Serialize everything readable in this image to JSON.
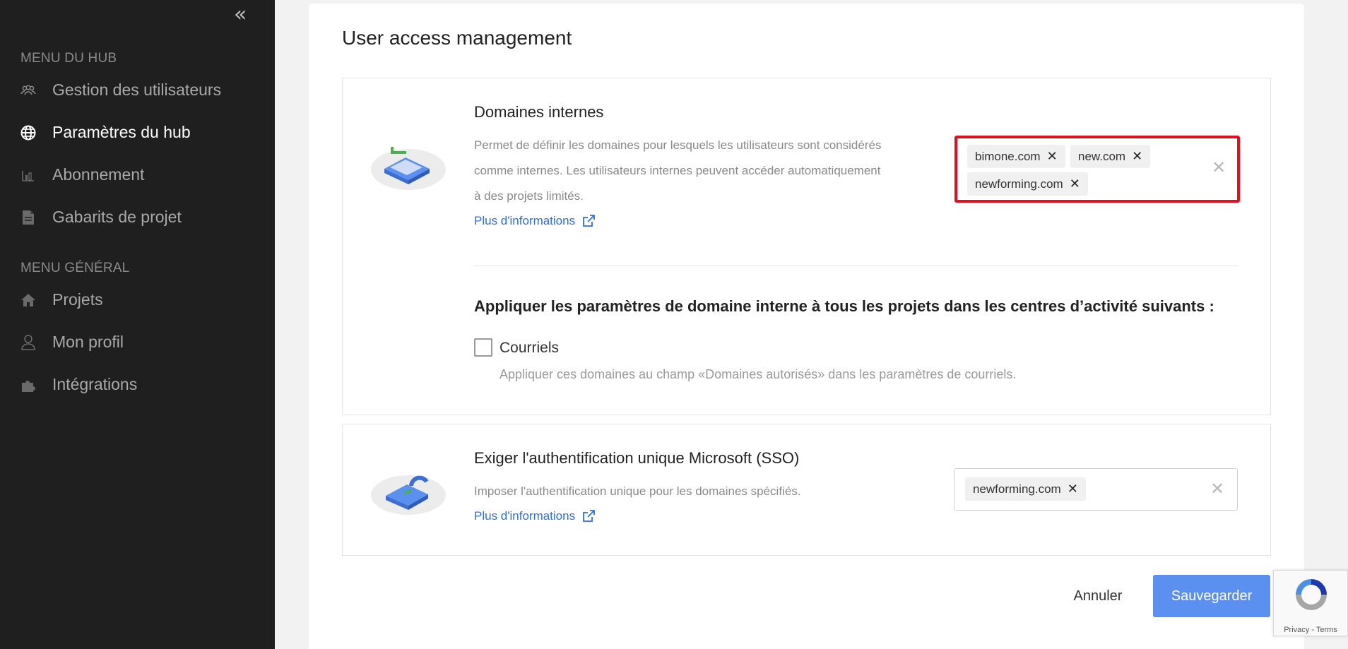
{
  "sidebar": {
    "collapse_glyph": "«",
    "hub_menu_title": "MENU DU HUB",
    "hub_items": [
      {
        "label": "Gestion des utilisateurs",
        "icon": "users-icon",
        "active": false
      },
      {
        "label": "Paramètres du hub",
        "icon": "globe-icon",
        "active": true
      },
      {
        "label": "Abonnement",
        "icon": "chart-icon",
        "active": false
      },
      {
        "label": "Gabarits de projet",
        "icon": "document-icon",
        "active": false
      }
    ],
    "general_menu_title": "MENU GÉNÉRAL",
    "general_items": [
      {
        "label": "Projets",
        "icon": "home-icon"
      },
      {
        "label": "Mon profil",
        "icon": "user-icon"
      },
      {
        "label": "Intégrations",
        "icon": "puzzle-icon"
      }
    ]
  },
  "page": {
    "title": "User access management"
  },
  "internal_domains": {
    "title": "Domaines internes",
    "description_lines": [
      "Permet de définir les domaines pour lesquels les utilisateurs sont considérés",
      "comme internes. Les utilisateurs internes peuvent accéder automatiquement",
      "à des projets limités."
    ],
    "more_link": "Plus d'informations",
    "tags": [
      "bimone.com",
      "new.com",
      "newforming.com"
    ],
    "tag_remove_glyph": "✕",
    "clear_glyph": "✕"
  },
  "apply_settings": {
    "title": "Appliquer les paramètres de domaine interne à tous les projets dans les centres d’activité suivants :",
    "checkbox_label": "Courriels",
    "checkbox_checked": false,
    "help": "Appliquer ces domaines au champ «Domaines autorisés» dans les paramètres de courriels."
  },
  "sso": {
    "title": "Exiger l'authentification unique Microsoft (SSO)",
    "description": "Imposer l'authentification unique pour les domaines spécifiés.",
    "more_link": "Plus d'informations",
    "tags": [
      "newforming.com"
    ]
  },
  "actions": {
    "cancel": "Annuler",
    "save": "Sauvegarder"
  },
  "recaptcha": {
    "terms": "Privacy - Terms"
  },
  "colors": {
    "sidebar_bg": "#1f1f1f",
    "accent": "#5b8ff0",
    "link": "#2f6fde",
    "highlight": "#e0101e"
  }
}
